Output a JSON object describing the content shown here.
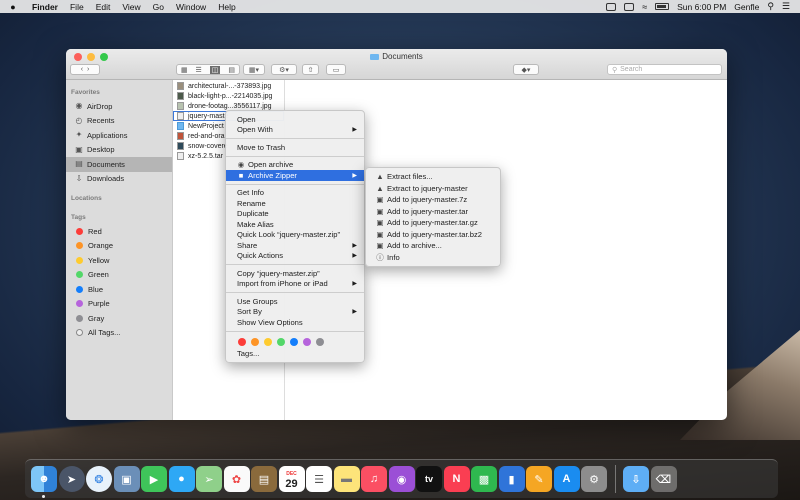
{
  "menubar": {
    "apple": "",
    "app": "Finder",
    "items": [
      "File",
      "Edit",
      "View",
      "Go",
      "Window",
      "Help"
    ],
    "clock": "Sun 6:00 PM",
    "user": "Genfle"
  },
  "window": {
    "title": "Documents",
    "search_placeholder": "Search"
  },
  "sidebar": {
    "favorites_header": "Favorites",
    "favorites": [
      {
        "label": "AirDrop",
        "icon": "airdrop-icon"
      },
      {
        "label": "Recents",
        "icon": "clock-icon"
      },
      {
        "label": "Applications",
        "icon": "applications-icon"
      },
      {
        "label": "Desktop",
        "icon": "desktop-icon"
      },
      {
        "label": "Documents",
        "icon": "document-icon"
      },
      {
        "label": "Downloads",
        "icon": "download-icon"
      }
    ],
    "locations_header": "Locations",
    "tags_header": "Tags",
    "tags": [
      {
        "label": "Red",
        "color": "#fc3d39"
      },
      {
        "label": "Orange",
        "color": "#fd9426"
      },
      {
        "label": "Yellow",
        "color": "#fecb2f"
      },
      {
        "label": "Green",
        "color": "#53d769"
      },
      {
        "label": "Blue",
        "color": "#147efb"
      },
      {
        "label": "Purple",
        "color": "#b664dc"
      },
      {
        "label": "Gray",
        "color": "#8e8e93"
      },
      {
        "label": "All Tags...",
        "color": ""
      }
    ]
  },
  "files": [
    "architectural-...-373893.jpg",
    "black-light-p...-2214035.jpg",
    "drone-footag...3556117.jpg",
    "jquery-maste",
    "NewProject",
    "red-and-ora",
    "snow-covere",
    "xz-5.2.5.tar"
  ],
  "context_menu": {
    "g1": [
      "Open",
      "Open With"
    ],
    "g2": [
      "Move to Trash"
    ],
    "g3": [
      "Open archive",
      "Archive Zipper"
    ],
    "g4": [
      "Get Info",
      "Rename",
      "Duplicate",
      "Make Alias",
      "Quick Look “jquery-master.zip”",
      "Share",
      "Quick Actions"
    ],
    "g5": [
      "Copy “jquery-master.zip”",
      "Import from iPhone or iPad"
    ],
    "g6": [
      "Use Groups",
      "Sort By",
      "Show View Options"
    ],
    "tag_colors": [
      "#fc3d39",
      "#fd9426",
      "#fecb2f",
      "#53d769",
      "#147efb",
      "#b664dc",
      "#8e8e93"
    ],
    "tags_label": "Tags..."
  },
  "submenu": {
    "items": [
      {
        "label": "Extract files...",
        "icon": "extract-icon"
      },
      {
        "label": "Extract to jquery-master",
        "icon": "extract-icon"
      },
      {
        "label": "Add to jquery-master.7z",
        "icon": "box-icon"
      },
      {
        "label": "Add to jquery-master.tar",
        "icon": "box-icon"
      },
      {
        "label": "Add to jquery-master.tar.gz",
        "icon": "box-icon"
      },
      {
        "label": "Add to jquery-master.tar.bz2",
        "icon": "box-icon"
      },
      {
        "label": "Add to archive...",
        "icon": "box-icon"
      },
      {
        "label": "Info",
        "icon": "info-icon"
      }
    ]
  },
  "dock": {
    "calendar_month": "DEC",
    "calendar_day": "29",
    "tv_label": "tv",
    "apps": [
      "Finder",
      "Launchpad",
      "Safari",
      "Preview",
      "FaceTime",
      "Messages",
      "Maps",
      "Photos",
      "Notes Book",
      "Calendar",
      "Reminders",
      "Notes",
      "Music",
      "Podcasts",
      "TV",
      "News",
      "Numbers",
      "Keynote",
      "Pages",
      "App Store",
      "System Preferences",
      "Downloads",
      "Trash"
    ]
  }
}
